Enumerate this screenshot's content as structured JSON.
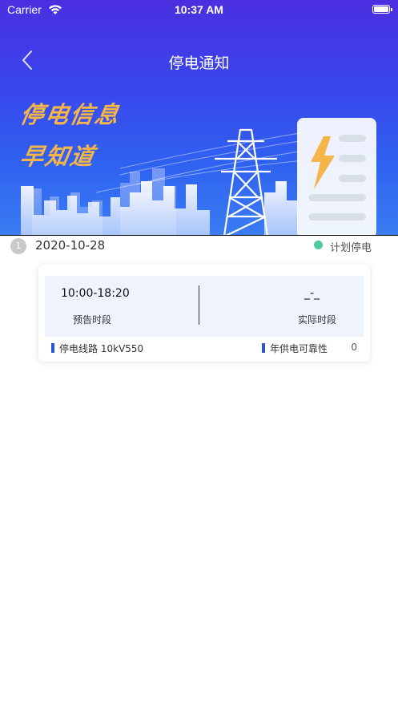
{
  "status_bar": {
    "carrier": "Carrier",
    "time": "10:37 AM"
  },
  "nav": {
    "title": "停电通知",
    "back_icon": "chevron-left-icon"
  },
  "hero": {
    "slogan_line1": "停电信息",
    "slogan_line2": "早知道"
  },
  "notice": {
    "index": "1",
    "date": "2020-10-28",
    "status_label": "计划停电",
    "status_color": "#4fc9a0",
    "forecast_time": "10:00-18:20",
    "forecast_label": "预告时段",
    "actual_time": "_-_",
    "actual_label": "实际时段",
    "line_label": "停电线路",
    "line_value": "10kV550",
    "reliability_label": "年供电可靠性",
    "reliability_value": "0"
  },
  "colors": {
    "hero_top": "#4a2fe0",
    "hero_bottom": "#3a7df2",
    "slogan": "#f5b548",
    "accent_blue": "#2a55d8"
  }
}
